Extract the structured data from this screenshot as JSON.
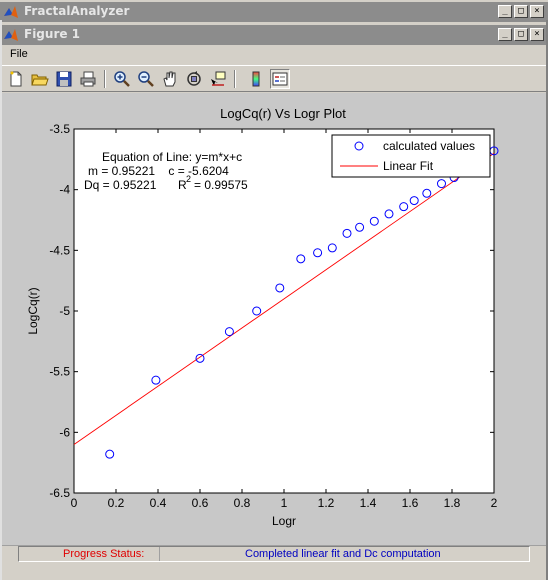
{
  "app_window": {
    "title": "FractalAnalyzer",
    "buttons": [
      "_",
      "□",
      "×"
    ]
  },
  "figure_window": {
    "title": "Figure 1",
    "buttons": [
      "_",
      "□",
      "×"
    ]
  },
  "menu": {
    "file_label": "File"
  },
  "toolbar": {
    "icons": [
      "new-file-icon",
      "open-folder-icon",
      "save-icon",
      "print-icon",
      "zoom-in-icon",
      "zoom-out-icon",
      "pan-hand-icon",
      "rotate-3d-icon",
      "data-cursor-icon",
      "colorbar-icon",
      "legend-icon"
    ],
    "active": "legend-icon"
  },
  "status": {
    "label": "Progress Status:",
    "message": "Completed linear fit and Dc computation",
    "label_color": "#e00000",
    "message_color": "#0000c0"
  },
  "chart_data": {
    "type": "scatter",
    "title": "LogCq(r) Vs Logr Plot",
    "xlabel": "Logr",
    "ylabel": "LogCq(r)",
    "xlim": [
      0,
      2
    ],
    "ylim": [
      -6.5,
      -3.5
    ],
    "xticks": [
      0,
      0.2,
      0.4,
      0.6,
      0.8,
      1,
      1.2,
      1.4,
      1.6,
      1.8,
      2
    ],
    "xtick_labels": [
      "0",
      "0.2",
      "0.4",
      "0.6",
      "0.8",
      "1",
      "1.2",
      "1.4",
      "1.6",
      "1.8",
      "2"
    ],
    "yticks": [
      -6.5,
      -6,
      -5.5,
      -5,
      -4.5,
      -4,
      -3.5
    ],
    "ytick_labels": [
      "-6.5",
      "-6",
      "-5.5",
      "-5",
      "-4.5",
      "-4",
      "-3.5"
    ],
    "grid": false,
    "legend_position": "top-right",
    "series": [
      {
        "name": "calculated values",
        "marker": "circle",
        "color": "#0000ff",
        "x": [
          0.17,
          0.39,
          0.6,
          0.74,
          0.87,
          0.98,
          1.08,
          1.16,
          1.23,
          1.3,
          1.36,
          1.43,
          1.5,
          1.57,
          1.62,
          1.68,
          1.75,
          1.81,
          2.0
        ],
        "y": [
          -6.18,
          -5.57,
          -5.39,
          -5.17,
          -5.0,
          -4.81,
          -4.57,
          -4.52,
          -4.48,
          -4.36,
          -4.31,
          -4.26,
          -4.2,
          -4.14,
          -4.09,
          -4.03,
          -3.95,
          -3.9,
          -3.68
        ]
      },
      {
        "name": "Linear Fit",
        "line": true,
        "color": "#ff0000",
        "x": [
          0,
          2
        ],
        "y": [
          -6.1,
          -3.7
        ]
      }
    ],
    "annotations": [
      "Equation of Line: y=m*x+c",
      "m = 0.95221    c = -5.6204",
      "Dq = 0.95221",
      "R",
      "2",
      "= 0.99575"
    ]
  }
}
